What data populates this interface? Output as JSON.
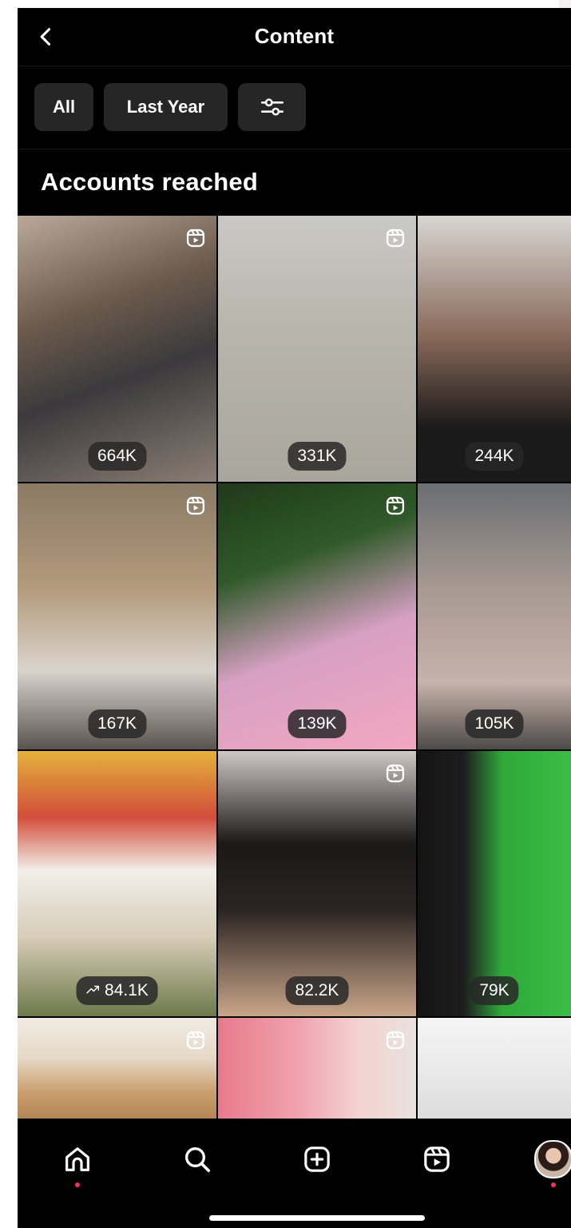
{
  "header": {
    "title": "Content",
    "back_icon": "chevron-left-icon"
  },
  "filters": {
    "all_label": "All",
    "period_label": "Last Year",
    "filter_icon": "sliders-icon"
  },
  "section": {
    "title": "Accounts reached"
  },
  "grid": {
    "items": [
      {
        "count": "664K",
        "reel": true,
        "trend": false,
        "bg": "linear-gradient(160deg,#b9a99b 0%,#6b5a4c 35%,#3b3a3c 60%,#8a7e74 100%)"
      },
      {
        "count": "331K",
        "reel": true,
        "trend": false,
        "bg": "linear-gradient(180deg,#c9c9c5 0%,#b9b6ad 40%,#a9a69e 100%)"
      },
      {
        "count": "244K",
        "reel": false,
        "trend": false,
        "bg": "linear-gradient(180deg,#d8d6d2 0%,#8a6a5a 45%,#1a1a1a 80%)"
      },
      {
        "count": "167K",
        "reel": true,
        "trend": false,
        "bg": "linear-gradient(180deg,#8a7a65 0%,#b49b7c 40%,#d9d4cc 70%,#5a5450 100%)"
      },
      {
        "count": "139K",
        "reel": true,
        "trend": false,
        "bg": "linear-gradient(160deg,#1f3a1a 0%,#2f5a28 30%,#d7a0c3 60%,#f2a7c0 100%)"
      },
      {
        "count": "105K",
        "reel": false,
        "trend": false,
        "bg": "linear-gradient(180deg,#6a6e72 0%,#a89a92 40%,#c6b3aa 75%,#4c4a48 100%)"
      },
      {
        "count": "84.1K",
        "reel": false,
        "trend": true,
        "bg": "linear-gradient(180deg,#e4b13a 0%,#d24e3b 25%,#f1efe9 45%,#d8cdb8 70%,#6e7a4b 100%)"
      },
      {
        "count": "82.2K",
        "reel": true,
        "trend": false,
        "bg": "linear-gradient(180deg,#cfc8c5 0%,#1a1818 35%,#2b2423 60%,#c9a689 100%)"
      },
      {
        "count": "79K",
        "reel": false,
        "trend": false,
        "bg": "linear-gradient(90deg,#141414 0%,#1d1d1d 30%,#2fa83a 55%,#3bbd45 100%)"
      },
      {
        "count": "",
        "reel": true,
        "trend": false,
        "bg": "linear-gradient(180deg,#f1ebe4 0%,#e6d9c6 40%,#c89d6c 75%,#b48655 100%)"
      },
      {
        "count": "",
        "reel": true,
        "trend": false,
        "bg": "linear-gradient(90deg,#e87a8c 0%,#f0a2ad 40%,#f3d2cf 70%,#e9e2df 100%)"
      },
      {
        "count": "",
        "reel": false,
        "trend": false,
        "bg": "linear-gradient(180deg,#f5f5f5 0%,#e7e7e7 60%,#dcdcdc 100%)"
      }
    ]
  },
  "nav": {
    "home_icon": "home-icon",
    "search_icon": "search-icon",
    "create_icon": "plus-square-icon",
    "reels_icon": "reels-icon",
    "profile_icon": "avatar"
  },
  "colors": {
    "background": "#000000",
    "chip": "#262626",
    "notification_dot": "#ff2d55"
  }
}
